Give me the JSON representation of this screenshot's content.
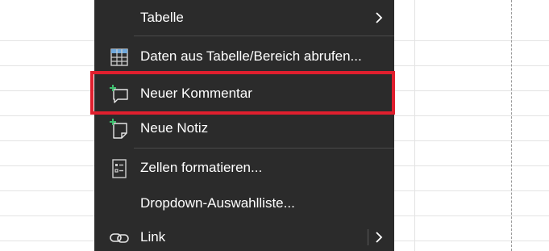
{
  "menu": {
    "items": [
      {
        "id": "tabelle",
        "label": "Tabelle",
        "icon": "none",
        "has_submenu": true
      },
      {
        "id": "daten",
        "label": "Daten aus Tabelle/Bereich abrufen...",
        "icon": "table-icon",
        "has_submenu": false
      },
      {
        "id": "kommentar",
        "label": "Neuer Kommentar",
        "icon": "new-comment-icon",
        "has_submenu": false,
        "highlighted": true
      },
      {
        "id": "notiz",
        "label": "Neue Notiz",
        "icon": "new-note-icon",
        "has_submenu": false
      },
      {
        "id": "formatieren",
        "label": "Zellen formatieren...",
        "icon": "format-cells-icon",
        "has_submenu": false
      },
      {
        "id": "dropdown",
        "label": "Dropdown-Auswahlliste...",
        "icon": "none",
        "has_submenu": false
      },
      {
        "id": "link",
        "label": "Link",
        "icon": "link-icon",
        "has_submenu": true
      }
    ]
  },
  "colors": {
    "menu_background": "#2b2b2b",
    "menu_text": "#ffffff",
    "highlight_border": "#e01f2e",
    "icon_accent_green": "#3fbf6f"
  }
}
